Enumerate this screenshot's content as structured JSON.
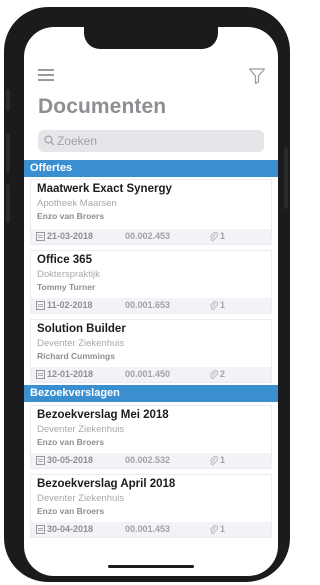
{
  "header": {
    "title": "Documenten",
    "menu_icon": "menu-icon",
    "filter_icon": "filter-icon"
  },
  "search": {
    "placeholder": "Zoeken"
  },
  "sections": [
    {
      "label": "Offertes",
      "items": [
        {
          "title": "Maatwerk Exact Synergy",
          "company": "Apotheek Maarsen",
          "person": "Enzo van Broers",
          "date": "21-03-2018",
          "number": "00.002.453",
          "attachments": "1"
        },
        {
          "title": "Office 365",
          "company": "Dokterspraktijk",
          "person": "Tommy Turner",
          "date": "11-02-2018",
          "number": "00.001.653",
          "attachments": "1"
        },
        {
          "title": "Solution Builder",
          "company": "Deventer Ziekenhuis",
          "person": "Richard Cummings",
          "date": "12-01-2018",
          "number": "00.001.450",
          "attachments": "2"
        }
      ]
    },
    {
      "label": "Bezoekverslagen",
      "items": [
        {
          "title": "Bezoekverslag Mei 2018",
          "company": "Deventer Ziekenhuis",
          "person": "Enzo van Broers",
          "date": "30-05-2018",
          "number": "00.002.532",
          "attachments": "1"
        },
        {
          "title": "Bezoekverslag April 2018",
          "company": "Deventer Ziekenhuis",
          "person": "Enzo van Broers",
          "date": "30-04-2018",
          "number": "00.001.453",
          "attachments": "1"
        }
      ]
    }
  ],
  "colors": {
    "accent": "#3a8fd1",
    "title_gray": "#8e8e93",
    "footer_bg": "#f2f2f7"
  }
}
